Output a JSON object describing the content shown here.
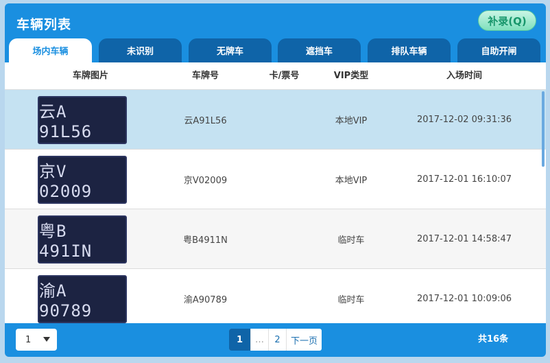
{
  "header": {
    "title": "车辆列表",
    "supplement_button": "补录(Q)"
  },
  "tabs": [
    {
      "label": "场内车辆"
    },
    {
      "label": "未识别"
    },
    {
      "label": "无牌车"
    },
    {
      "label": "遮挡车"
    },
    {
      "label": "排队车辆"
    },
    {
      "label": "自助开闸"
    }
  ],
  "table": {
    "columns": [
      "车牌图片",
      "车牌号",
      "卡/票号",
      "VIP类型",
      "入场时间"
    ],
    "rows": [
      {
        "plate_image_text": "云A 91L56",
        "plate": "云A91L56",
        "card": "",
        "vip": "本地VIP",
        "time": "2017-12-02 09:31:36"
      },
      {
        "plate_image_text": "京V 02009",
        "plate": "京V02009",
        "card": "",
        "vip": "本地VIP",
        "time": "2017-12-01 16:10:07"
      },
      {
        "plate_image_text": "粤B 491IN",
        "plate": "粤B4911N",
        "card": "",
        "vip": "临时车",
        "time": "2017-12-01 14:58:47"
      },
      {
        "plate_image_text": "渝A 90789",
        "plate": "渝A90789",
        "card": "",
        "vip": "临时车",
        "time": "2017-12-01 10:09:06"
      }
    ]
  },
  "footer": {
    "page_size_value": "1",
    "pagination": [
      "1",
      "…",
      "2",
      "下一页"
    ],
    "total": "共16条"
  },
  "colors": {
    "accent": "#1a8fe0",
    "tab_dark": "#0f64a8",
    "selected_row": "#c5e2f2"
  },
  "icons": {
    "dropdown": "caret-down-icon"
  }
}
